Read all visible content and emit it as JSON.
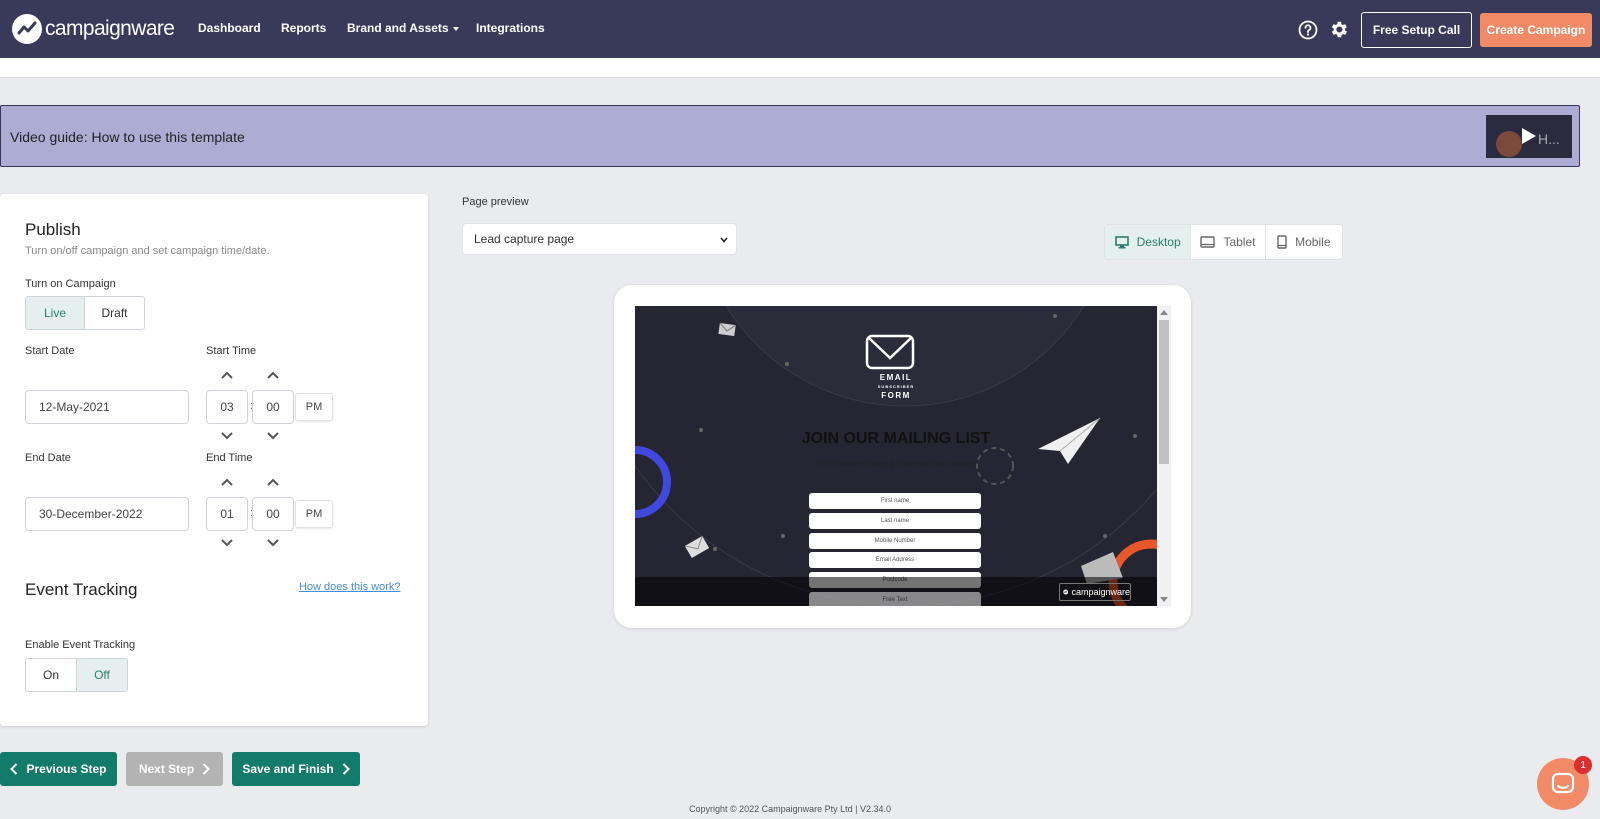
{
  "app": {
    "brand": "campaignware"
  },
  "nav": {
    "items": [
      {
        "label": "Dashboard"
      },
      {
        "label": "Reports"
      },
      {
        "label": "Brand and Assets"
      },
      {
        "label": "Integrations"
      }
    ],
    "setup_call": "Free Setup Call",
    "create_campaign": "Create Campaign",
    "icons": [
      "help-icon",
      "gear-icon"
    ]
  },
  "video_guide": {
    "title": "Video guide: How to use this template",
    "thumb_text": "H..."
  },
  "publish": {
    "title": "Publish",
    "subtitle": "Turn on/off campaign and set campaign time/date.",
    "turn_on_label": "Turn on Campaign",
    "live": "Live",
    "draft": "Draft",
    "start_date_label": "Start Date",
    "start_time_label": "Start Time",
    "start_date": "12-May-2021",
    "start_hour": "03",
    "start_minute": "00",
    "start_ampm": "PM",
    "end_date_label": "End Date",
    "end_time_label": "End Time",
    "end_date": "30-December-2022",
    "end_hour": "01",
    "end_minute": "00",
    "end_ampm": "PM",
    "colon": ":"
  },
  "event_tracking": {
    "title": "Event Tracking",
    "help_link": "How does this work?",
    "enable_label": "Enable Event Tracking",
    "on": "On",
    "off": "Off"
  },
  "preview": {
    "label": "Page preview",
    "selected_page": "Lead capture page",
    "devices": [
      "Desktop",
      "Tablet",
      "Mobile"
    ],
    "active_device": "Desktop",
    "content": {
      "brand_line1": "EMAIL",
      "brand_line2": "SUBSCRIBER",
      "brand_line3": "FORM",
      "heading": "JOIN OUR MAILING LIST",
      "subheading": "Fill in this form to stay up to date with our company",
      "fields": [
        "First name",
        "Last name",
        "Mobile Number",
        "Email Address",
        "Postcode",
        "Free Text"
      ],
      "badge": "campaignware"
    }
  },
  "steps": {
    "previous": "Previous Step",
    "next": "Next Step",
    "save": "Save and Finish"
  },
  "footer": {
    "copyright": "Copyright © 2022 Campaignware Pty Ltd  |  V2.34.0"
  },
  "chat": {
    "unread": "1"
  },
  "colors": {
    "nav_bg": "#393a5a",
    "accent_orange": "#f28a67",
    "primary_green": "#137b69",
    "banner": "#adadd4"
  }
}
